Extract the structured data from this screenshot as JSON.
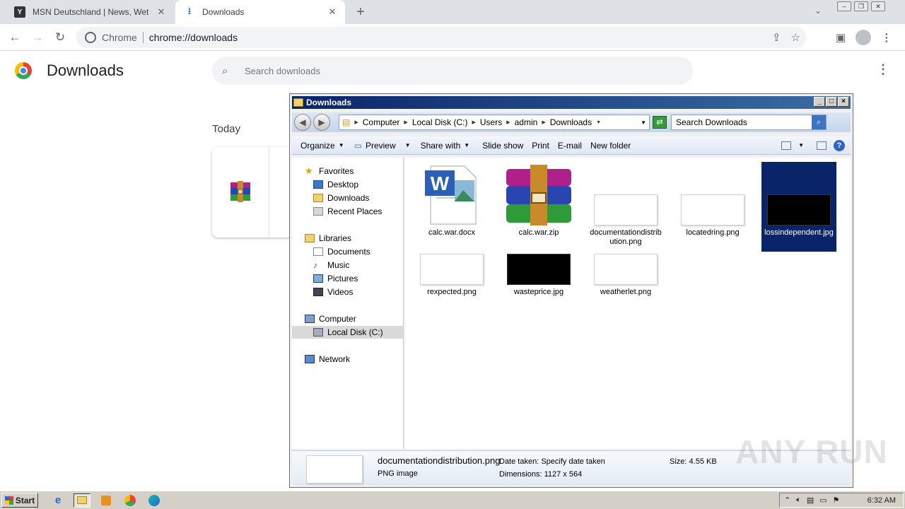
{
  "browser": {
    "tabs": [
      {
        "title": "MSN Deutschland | News, Wetter, St",
        "favicon": "msn-icon",
        "active": false
      },
      {
        "title": "Downloads",
        "favicon": "download-icon",
        "active": true
      }
    ],
    "omnibox": {
      "site_label": "Chrome",
      "url": "chrome://downloads"
    }
  },
  "downloads_page": {
    "title": "Downloads",
    "search_placeholder": "Search downloads",
    "section_today": "Today"
  },
  "explorer": {
    "title": "Downloads",
    "breadcrumb": [
      "Computer",
      "Local Disk (C:)",
      "Users",
      "admin",
      "Downloads"
    ],
    "search_placeholder": "Search Downloads",
    "commands": [
      "Organize",
      "Preview",
      "Share with",
      "Slide show",
      "Print",
      "E-mail",
      "New folder"
    ],
    "nav": {
      "favorites": "Favorites",
      "desktop": "Desktop",
      "downloads": "Downloads",
      "recent": "Recent Places",
      "libraries": "Libraries",
      "documents": "Documents",
      "music": "Music",
      "pictures": "Pictures",
      "videos": "Videos",
      "computer": "Computer",
      "local_disk": "Local Disk (C:)",
      "network": "Network"
    },
    "files": [
      {
        "name": "calc.war.docx",
        "type": "word"
      },
      {
        "name": "calc.war.zip",
        "type": "winrar"
      },
      {
        "name": "documentationdistribution.png",
        "type": "png-white"
      },
      {
        "name": "locatedring.png",
        "type": "png-white"
      },
      {
        "name": "lossindependent.jpg",
        "type": "jpg-black",
        "selected": true
      },
      {
        "name": "rexpected.png",
        "type": "png-white"
      },
      {
        "name": "wasteprice.jpg",
        "type": "jpg-black"
      },
      {
        "name": "weatherlet.png",
        "type": "png-white"
      }
    ],
    "details": {
      "filename": "documentationdistribution.png",
      "filetype": "PNG image",
      "date_taken_label": "Date taken:",
      "date_taken_value": "Specify date taken",
      "dimensions_label": "Dimensions:",
      "dimensions_value": "1127 x 564",
      "size_label": "Size:",
      "size_value": "4.55 KB"
    }
  },
  "taskbar": {
    "start_label": "Start",
    "clock": "6:32 AM"
  },
  "watermark": "ANY RUN"
}
